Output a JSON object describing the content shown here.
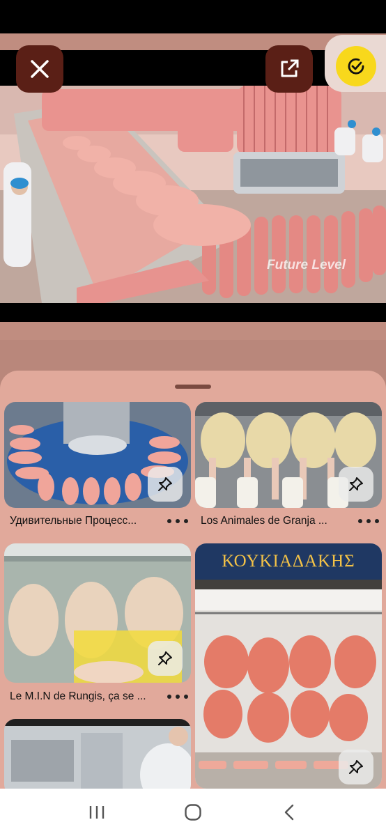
{
  "viewer": {
    "watermark": "Future Level",
    "close_icon": "close-icon",
    "share_icon": "external-link-icon",
    "lens_icon": "visual-search-icon",
    "lens_color": "#f8d81c"
  },
  "results": [
    {
      "title": "Удивительные Процесс...",
      "pin_icon": "pin-icon"
    },
    {
      "title": "Los Animales de Granja ...",
      "pin_icon": "pin-icon"
    },
    {
      "title": "Le M.I.N de Rungis, ça se ...",
      "pin_icon": "pin-icon"
    },
    {
      "title": "",
      "pin_icon": "pin-icon"
    },
    {
      "title": "",
      "sign_text": "ΚΟΥΚΙΑΔΑΚΗΣ",
      "pin_icon": "pin-icon"
    }
  ],
  "nav": {
    "recents": "recents-icon",
    "home": "home-icon",
    "back": "back-icon"
  }
}
